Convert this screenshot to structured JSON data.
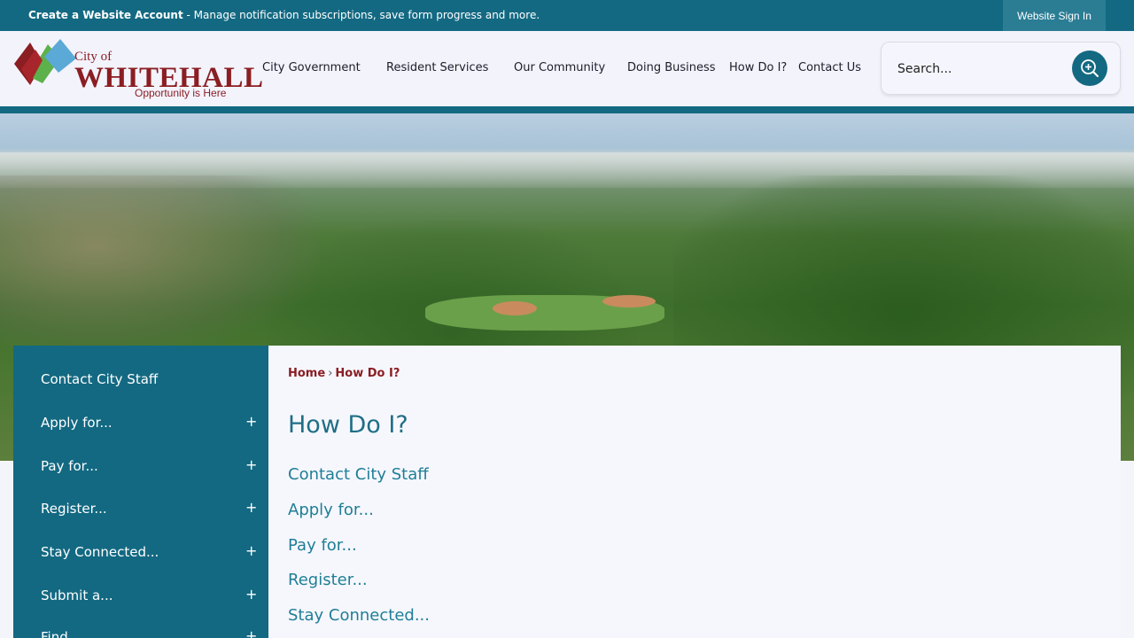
{
  "topbar": {
    "create_account_bold": "Create a Website Account",
    "create_account_rest": " - Manage notification subscriptions, save form progress and more.",
    "sign_in": "Website Sign In"
  },
  "logo": {
    "city_of": "City of",
    "name": "WHITEHALL",
    "tagline": "Opportunity is Here"
  },
  "nav": {
    "items": [
      {
        "label": "City Government"
      },
      {
        "label": "Resident Services"
      },
      {
        "label": "Our Community"
      },
      {
        "label": "Doing Business"
      },
      {
        "label": "How Do I?"
      },
      {
        "label": "Contact Us"
      }
    ]
  },
  "search": {
    "placeholder": "Search..."
  },
  "sidebar": {
    "items": [
      {
        "label": "Contact City Staff",
        "expandable": false
      },
      {
        "label": "Apply for...",
        "expandable": true
      },
      {
        "label": "Pay for...",
        "expandable": true
      },
      {
        "label": "Register...",
        "expandable": true
      },
      {
        "label": "Stay Connected...",
        "expandable": true
      },
      {
        "label": "Submit a...",
        "expandable": true
      },
      {
        "label": "Find...",
        "expandable": true
      }
    ],
    "expand_symbol": "+"
  },
  "breadcrumb": {
    "home": "Home",
    "separator": "›",
    "current": "How Do I?"
  },
  "main": {
    "title": "How Do I?",
    "links": [
      {
        "label": "Contact City Staff"
      },
      {
        "label": "Apply for..."
      },
      {
        "label": "Pay for..."
      },
      {
        "label": "Register..."
      },
      {
        "label": "Stay Connected..."
      }
    ]
  },
  "colors": {
    "primary_teal": "#136982",
    "brand_red": "#8a1e22",
    "link_teal": "#1f7e96"
  },
  "icons": {
    "search_button": "search-plus-icon",
    "logo_mark": "whitehall-ribbon-logo-icon"
  }
}
